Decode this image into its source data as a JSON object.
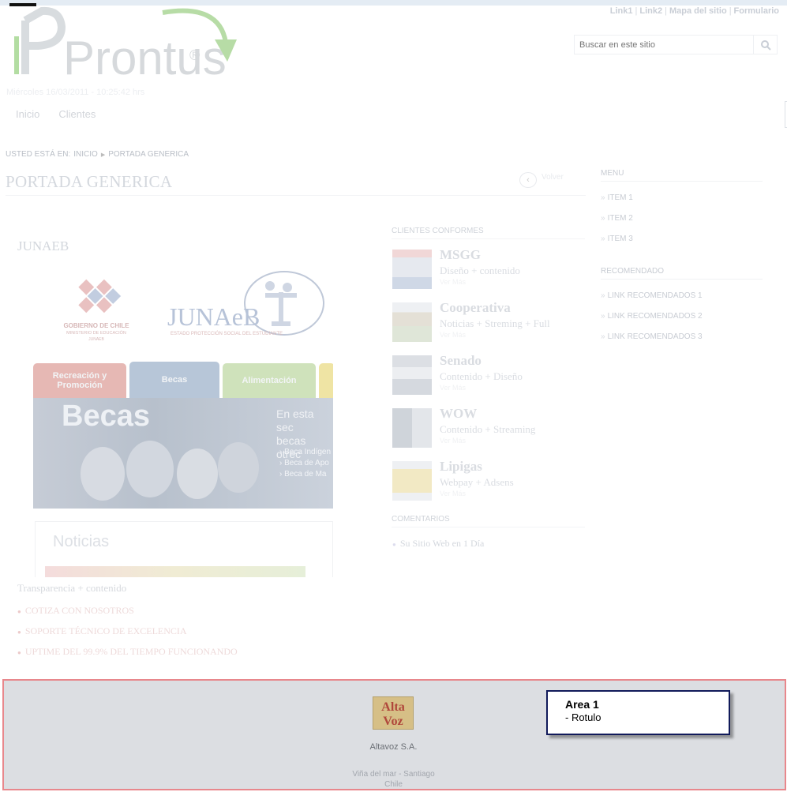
{
  "header": {
    "top_links": [
      "Link1",
      "Link2",
      "Mapa del sitio",
      "Formulario"
    ],
    "link_separator": "|",
    "logo_text": "Prontus",
    "logo_mark": "®",
    "search_placeholder": "Buscar en este sitio",
    "search_icon": "magnifier-icon",
    "dateline": "Miércoles 16/03/2011 - 10:25:42 hrs",
    "nav": [
      "Inicio",
      "Clientes"
    ]
  },
  "breadcrumb": {
    "prefix": "USTED ESTÁ EN:",
    "items": [
      "INICIO",
      "PORTADA GENERICA"
    ]
  },
  "page": {
    "title": "PORTADA GENERICA",
    "back_label": "Volver"
  },
  "sidebar": {
    "menu_title": "MENU",
    "menu_items": [
      "ITEM 1",
      "ITEM 2",
      "ITEM 3"
    ],
    "recommended_title": "RECOMENDADO",
    "recommended_items": [
      "LINK RECOMENDADOS 1",
      "LINK RECOMENDADOS 2",
      "LINK RECOMENDADOS 3"
    ]
  },
  "feature": {
    "title": "JUNAEB",
    "gob_line1": "GOBIERNO DE CHILE",
    "gob_line2": "MINISTERIO DE EDUCACIÓN",
    "gob_line3": "JUNAEB",
    "junaeb_logo_text": "JUNAeB",
    "junaeb_tagline": "ESTADO PROTECCIÓN SOCIAL DEL ESTUDIANTE",
    "tabs": [
      "Recreación y Promoción",
      "Becas",
      "Alimentación"
    ],
    "banner_title": "Becas",
    "banner_text_1": "En esta sec",
    "banner_text_2": "becas otrec",
    "banner_links": [
      "› Beca Indígen",
      "› Beca de Apo",
      "› Beca de Ma"
    ],
    "news_title": "Noticias",
    "caption": "Transparencia + contenido",
    "bullets": [
      "COTIZA CON NOSOTROS",
      "SOPORTE TÉCNICO DE EXCELENCIA",
      "UPTIME DEL 99.9% DEL TIEMPO FUNCIONANDO"
    ]
  },
  "clients": {
    "title": "CLIENTES CONFORMES",
    "more_label": "Ver Más",
    "items": [
      {
        "name": "MSGG",
        "desc": "Diseño + contenido"
      },
      {
        "name": "Cooperativa",
        "desc": "Noticias + Streming + Full"
      },
      {
        "name": "Senado",
        "desc": "Contenido + Diseño"
      },
      {
        "name": "WOW",
        "desc": "Contenido + Streaming"
      },
      {
        "name": "Lipigas",
        "desc": "Webpay + Adsens"
      }
    ]
  },
  "comments": {
    "title": "COMENTARIOS",
    "items": [
      "Su Sitio Web en 1 Día"
    ]
  },
  "footer": {
    "logo_line1": "Alta",
    "logo_line2": "Voz",
    "company": "Altavoz S.A.",
    "city_line1": "Viña del mar - Santiago",
    "city_line2": "Chile"
  },
  "tooltip": {
    "title": "Area 1",
    "subtitle": "- Rotulo"
  },
  "colors": {
    "accent_green": "#9bcf86",
    "logo_gray": "#cfd2d6",
    "highlight_border": "#e8878c",
    "tooltip_border": "#111a5a"
  }
}
